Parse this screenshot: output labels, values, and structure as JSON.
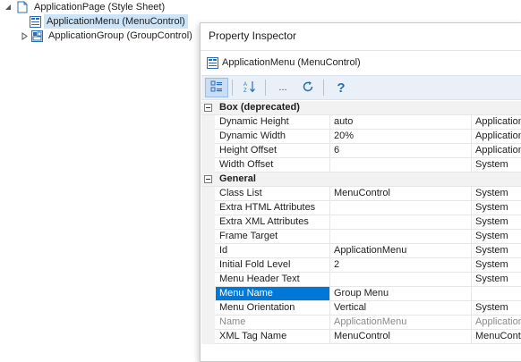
{
  "tree": [
    {
      "label": "ApplicationPage (Style Sheet)",
      "icon": "page-icon",
      "expander": "expanded"
    },
    {
      "label": "ApplicationMenu (MenuControl)",
      "icon": "menu-control-icon",
      "expander": "none",
      "selected": true
    },
    {
      "label": "ApplicationGroup (GroupControl)",
      "icon": "group-control-icon",
      "expander": "collapsed"
    }
  ],
  "inspector": {
    "title": "Property Inspector",
    "subject": "ApplicationMenu (MenuControl)",
    "toolbar": {
      "categorized_icon": "categorized-icon",
      "sort_icon": "sort-az-icon",
      "ellipsis": "...",
      "refresh_icon": "refresh-icon",
      "help": "?"
    },
    "categories": [
      {
        "name": "Box (deprecated)",
        "rows": [
          {
            "name": "Dynamic Height",
            "value": "auto",
            "source": "ApplicationMenu"
          },
          {
            "name": "Dynamic Width",
            "value": "20%",
            "source": "ApplicationMenu"
          },
          {
            "name": "Height Offset",
            "value": "6",
            "source": "ApplicationMenu"
          },
          {
            "name": "Width Offset",
            "value": "",
            "source": "System"
          }
        ]
      },
      {
        "name": "General",
        "rows": [
          {
            "name": "Class List",
            "value": "MenuControl",
            "source": "System"
          },
          {
            "name": "Extra HTML Attributes",
            "value": "",
            "source": "System"
          },
          {
            "name": "Extra XML Attributes",
            "value": "",
            "source": "System"
          },
          {
            "name": "Frame Target",
            "value": "",
            "source": "System"
          },
          {
            "name": "Id",
            "value": "ApplicationMenu",
            "source": "System"
          },
          {
            "name": "Initial Fold Level",
            "value": "2",
            "source": "System"
          },
          {
            "name": "Menu Header Text",
            "value": "",
            "source": "System"
          },
          {
            "name": "Menu Name",
            "value": "Group Menu",
            "source": "",
            "selected": true
          },
          {
            "name": "Menu Orientation",
            "value": "Vertical",
            "source": "System"
          },
          {
            "name": "Name",
            "value": "ApplicationMenu",
            "source": "ApplicationMenu",
            "inherited": true
          },
          {
            "name": "XML Tag Name",
            "value": "MenuControl",
            "source": "MenuControl"
          }
        ]
      }
    ]
  }
}
